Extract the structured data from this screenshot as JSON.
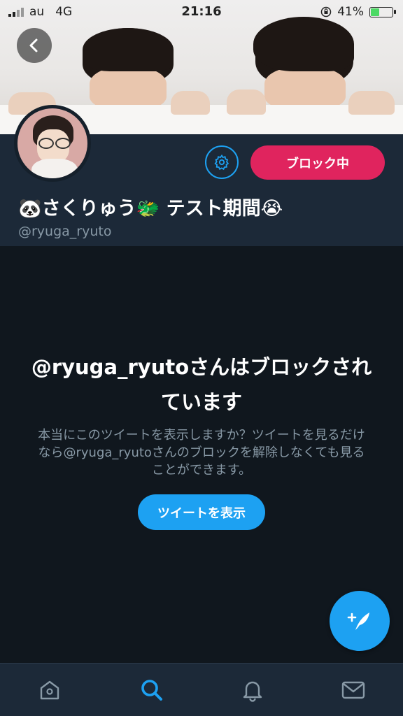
{
  "status_bar": {
    "carrier": "au",
    "network": "4G",
    "time": "21:16",
    "battery_percent": "41%",
    "battery_level": 0.41
  },
  "profile": {
    "display_name": "🐼さくりゅう🐲 テスト期間😭",
    "handle": "@ryuga_ryuto",
    "block_button_label": "ブロック中"
  },
  "blocked_message": {
    "title": "@ryuga_ryutoさんはブロックされています",
    "body": "本当にこのツイートを表示しますか？ツイートを見るだけなら@ryuga_ryutoさんのブロックを解除しなくても見ることができます。",
    "show_button_label": "ツイートを表示"
  },
  "icons": {
    "back": "chevron-left-icon",
    "settings": "gear-icon",
    "compose": "compose-tweet-icon",
    "tabs": [
      "home-icon",
      "search-icon",
      "notifications-icon",
      "messages-icon"
    ]
  },
  "colors": {
    "accent": "#1da1f2",
    "block": "#e0245e",
    "background": "#15202b"
  }
}
